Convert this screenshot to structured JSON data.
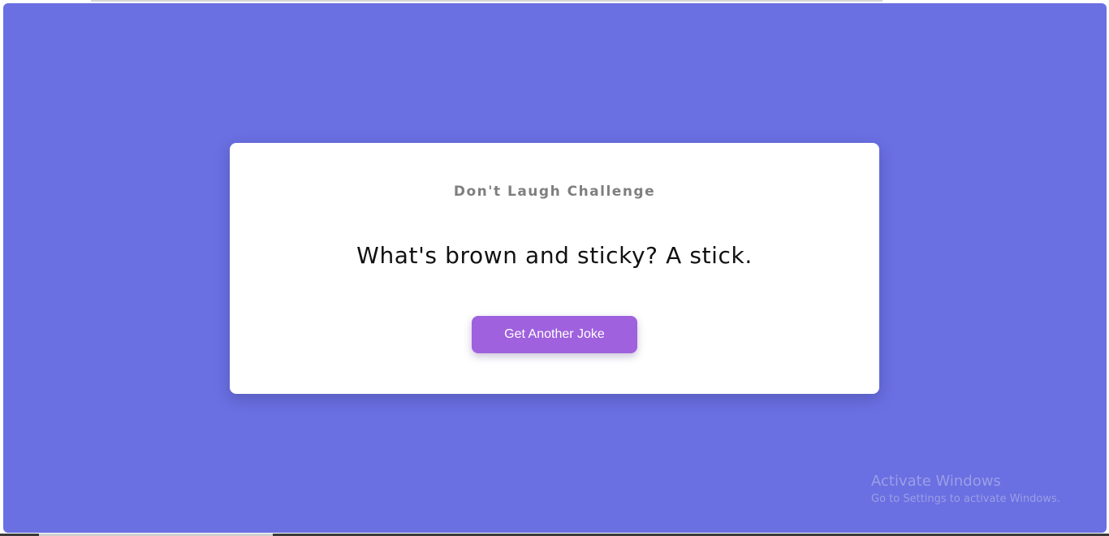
{
  "card": {
    "title": "Don't Laugh Challenge",
    "joke": "What's brown and sticky? A stick.",
    "button_label": "Get Another Joke"
  },
  "watermark": {
    "title": "Activate Windows",
    "subtitle": "Go to Settings to activate Windows."
  },
  "colors": {
    "background": "#6a6fe2",
    "card": "#ffffff",
    "button": "#9f61de",
    "title_text": "#7f7f7f",
    "joke_text": "#111111"
  }
}
